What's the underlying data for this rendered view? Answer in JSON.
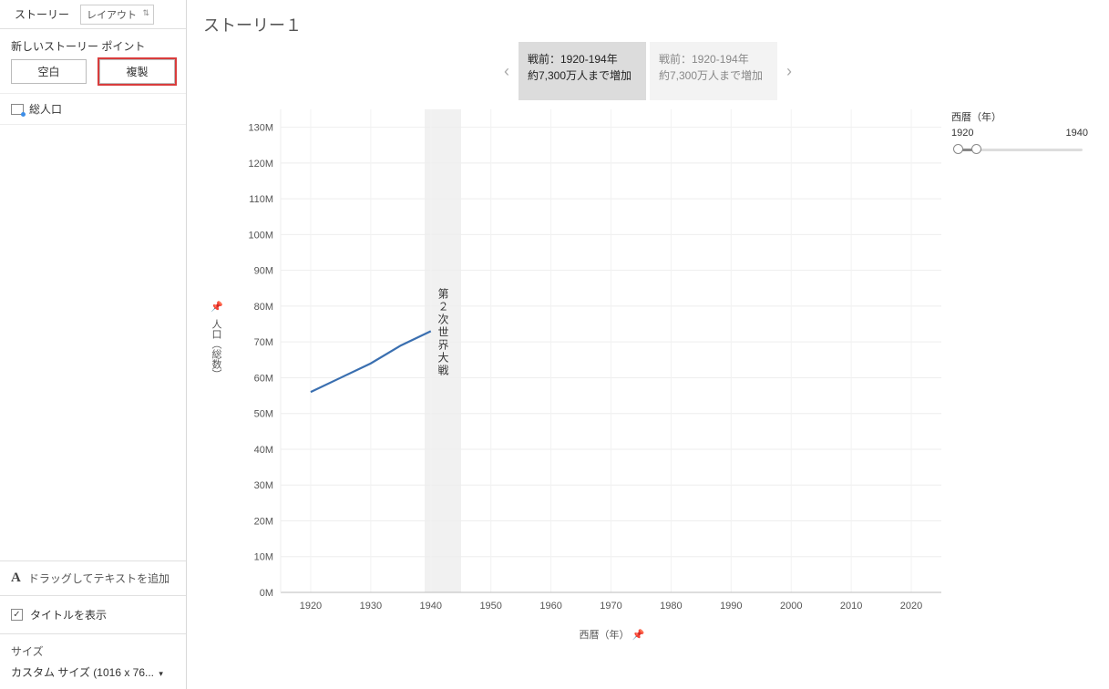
{
  "sidebar": {
    "tab_story": "ストーリー",
    "tab_layout": "レイアウト",
    "new_point_label": "新しいストーリー ポイント",
    "blank_btn": "空白",
    "dup_btn": "複製",
    "sheet_name": "総人口",
    "drag_text": "ドラッグしてテキストを追加",
    "show_title": "タイトルを表示",
    "size_label": "サイズ",
    "size_value": "カスタム サイズ (1016 x 76..."
  },
  "story": {
    "title": "ストーリー１",
    "points": [
      {
        "line1": "戦前：1920-194年",
        "line2": "約7,300万人まで増加",
        "active": true
      },
      {
        "line1": "戦前：1920-194年",
        "line2": "約7,300万人まで増加",
        "active": false
      }
    ]
  },
  "filter": {
    "title": "西暦（年）",
    "min": "1920",
    "max": "1940"
  },
  "axes": {
    "xlabel": "西暦（年）",
    "ylabel": "人口（総数）"
  },
  "annotation": "第２次世界大戦",
  "chart_data": {
    "type": "line",
    "title": "",
    "xlabel": "西暦（年）",
    "ylabel": "人口（総数）",
    "xlim": [
      1915,
      2025
    ],
    "ylim": [
      0,
      135
    ],
    "y_unit": "M",
    "x_ticks": [
      1920,
      1930,
      1940,
      1950,
      1960,
      1970,
      1980,
      1990,
      2000,
      2010,
      2020
    ],
    "y_ticks": [
      0,
      10,
      20,
      30,
      40,
      50,
      60,
      70,
      80,
      90,
      100,
      110,
      120,
      130
    ],
    "y_tick_labels": [
      "0M",
      "10M",
      "20M",
      "30M",
      "40M",
      "50M",
      "60M",
      "70M",
      "80M",
      "90M",
      "100M",
      "110M",
      "120M",
      "130M"
    ],
    "reference_band": {
      "x0": 1939,
      "x1": 1945,
      "label": "第２次世界大戦"
    },
    "series": [
      {
        "name": "総人口",
        "x": [
          1920,
          1925,
          1930,
          1935,
          1940
        ],
        "y": [
          56,
          60,
          64,
          69,
          73
        ]
      }
    ]
  }
}
